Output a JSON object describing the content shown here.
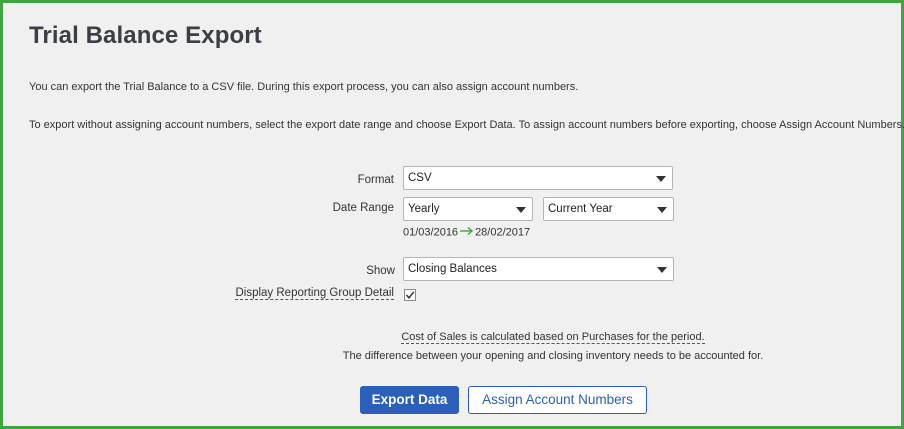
{
  "page": {
    "title": "Trial Balance Export",
    "intro_1": "You can export the Trial Balance to a CSV file. During this export process, you can also assign account numbers.",
    "intro_2": "To export without assigning account numbers, select the export date range and choose Export Data. To assign account numbers before exporting, choose Assign Account Numbers."
  },
  "form": {
    "format_label": "Format",
    "format_value": "CSV",
    "date_range_label": "Date Range",
    "period_value": "Yearly",
    "year_value": "Current Year",
    "range_start": "01/03/2016",
    "range_end": "28/02/2017",
    "show_label": "Show",
    "show_value": "Closing Balances",
    "group_detail_label": "Display Reporting Group Detail",
    "group_detail_checked": true
  },
  "notes": {
    "cost_of_sales": "Cost of Sales is calculated based on Purchases for the period.",
    "inventory": "The difference between your opening and closing inventory needs to be accounted for."
  },
  "buttons": {
    "export": "Export Data",
    "assign": "Assign Account Numbers"
  },
  "colors": {
    "frame_border": "#3fa33f",
    "primary": "#2b5fb9",
    "arrow": "#3fa33f"
  }
}
